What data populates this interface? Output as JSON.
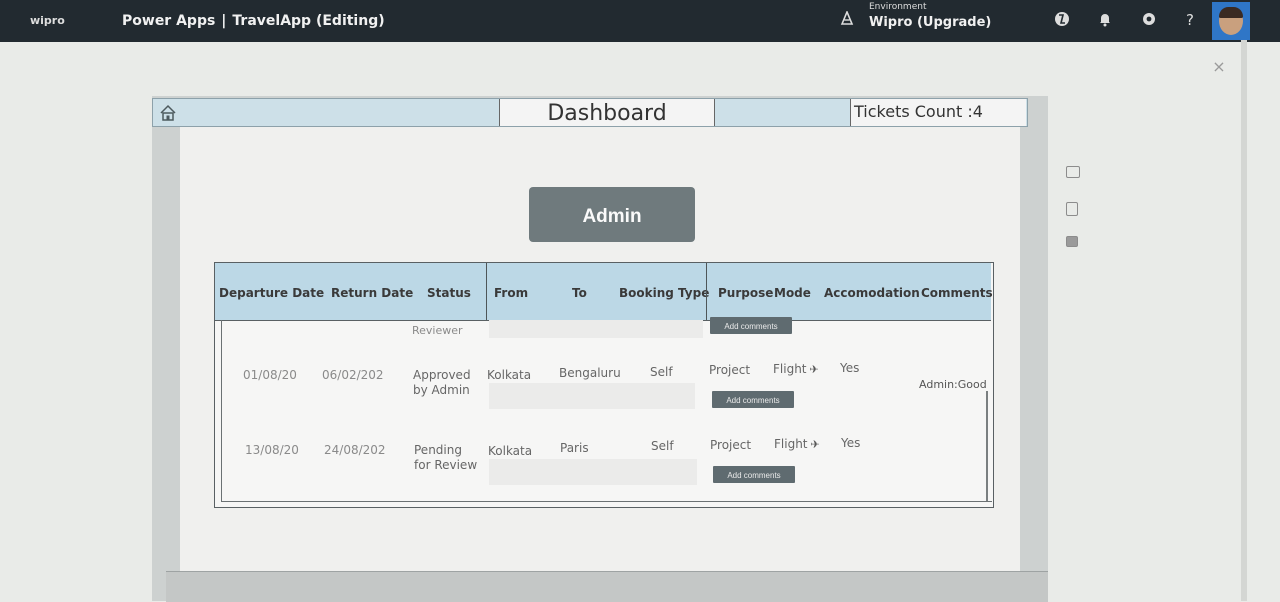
{
  "topbar": {
    "logo_text": "wipro",
    "product": "Power Apps",
    "separator": "|",
    "app_name": "TravelApp (Editing)",
    "environment_label": "Environment",
    "environment_name": "Wipro (Upgrade)",
    "help_glyph": "?"
  },
  "dashboard": {
    "title": "Dashboard",
    "tickets_count": "Tickets Count :4",
    "admin_button": "Admin"
  },
  "table": {
    "columns": [
      "Departure Date",
      "Return Date",
      "Status",
      "From",
      "To",
      "Booking Type",
      "Purpose",
      "Mode",
      "Accomodation",
      "Comments"
    ],
    "add_comments_label": "Add comments",
    "partial_row_status": "Reviewer",
    "rows": [
      {
        "departure": "01/08/20",
        "return": "06/02/202",
        "status_line1": "Approved",
        "status_line2": "by Admin",
        "from": "Kolkata",
        "to": "Bengaluru",
        "booking_type": "Self",
        "purpose": "Project",
        "mode": "Flight",
        "accomodation": "Yes",
        "comment": "Admin:Good"
      },
      {
        "departure": "13/08/20",
        "return": "24/08/202",
        "status_line1": "Pending",
        "status_line2": "for Review",
        "from": "Kolkata",
        "to": "Paris",
        "booking_type": "Self",
        "purpose": "Project",
        "mode": "Flight",
        "accomodation": "Yes",
        "comment": ""
      }
    ]
  },
  "icons": {
    "close": "×",
    "plane": "✈"
  }
}
